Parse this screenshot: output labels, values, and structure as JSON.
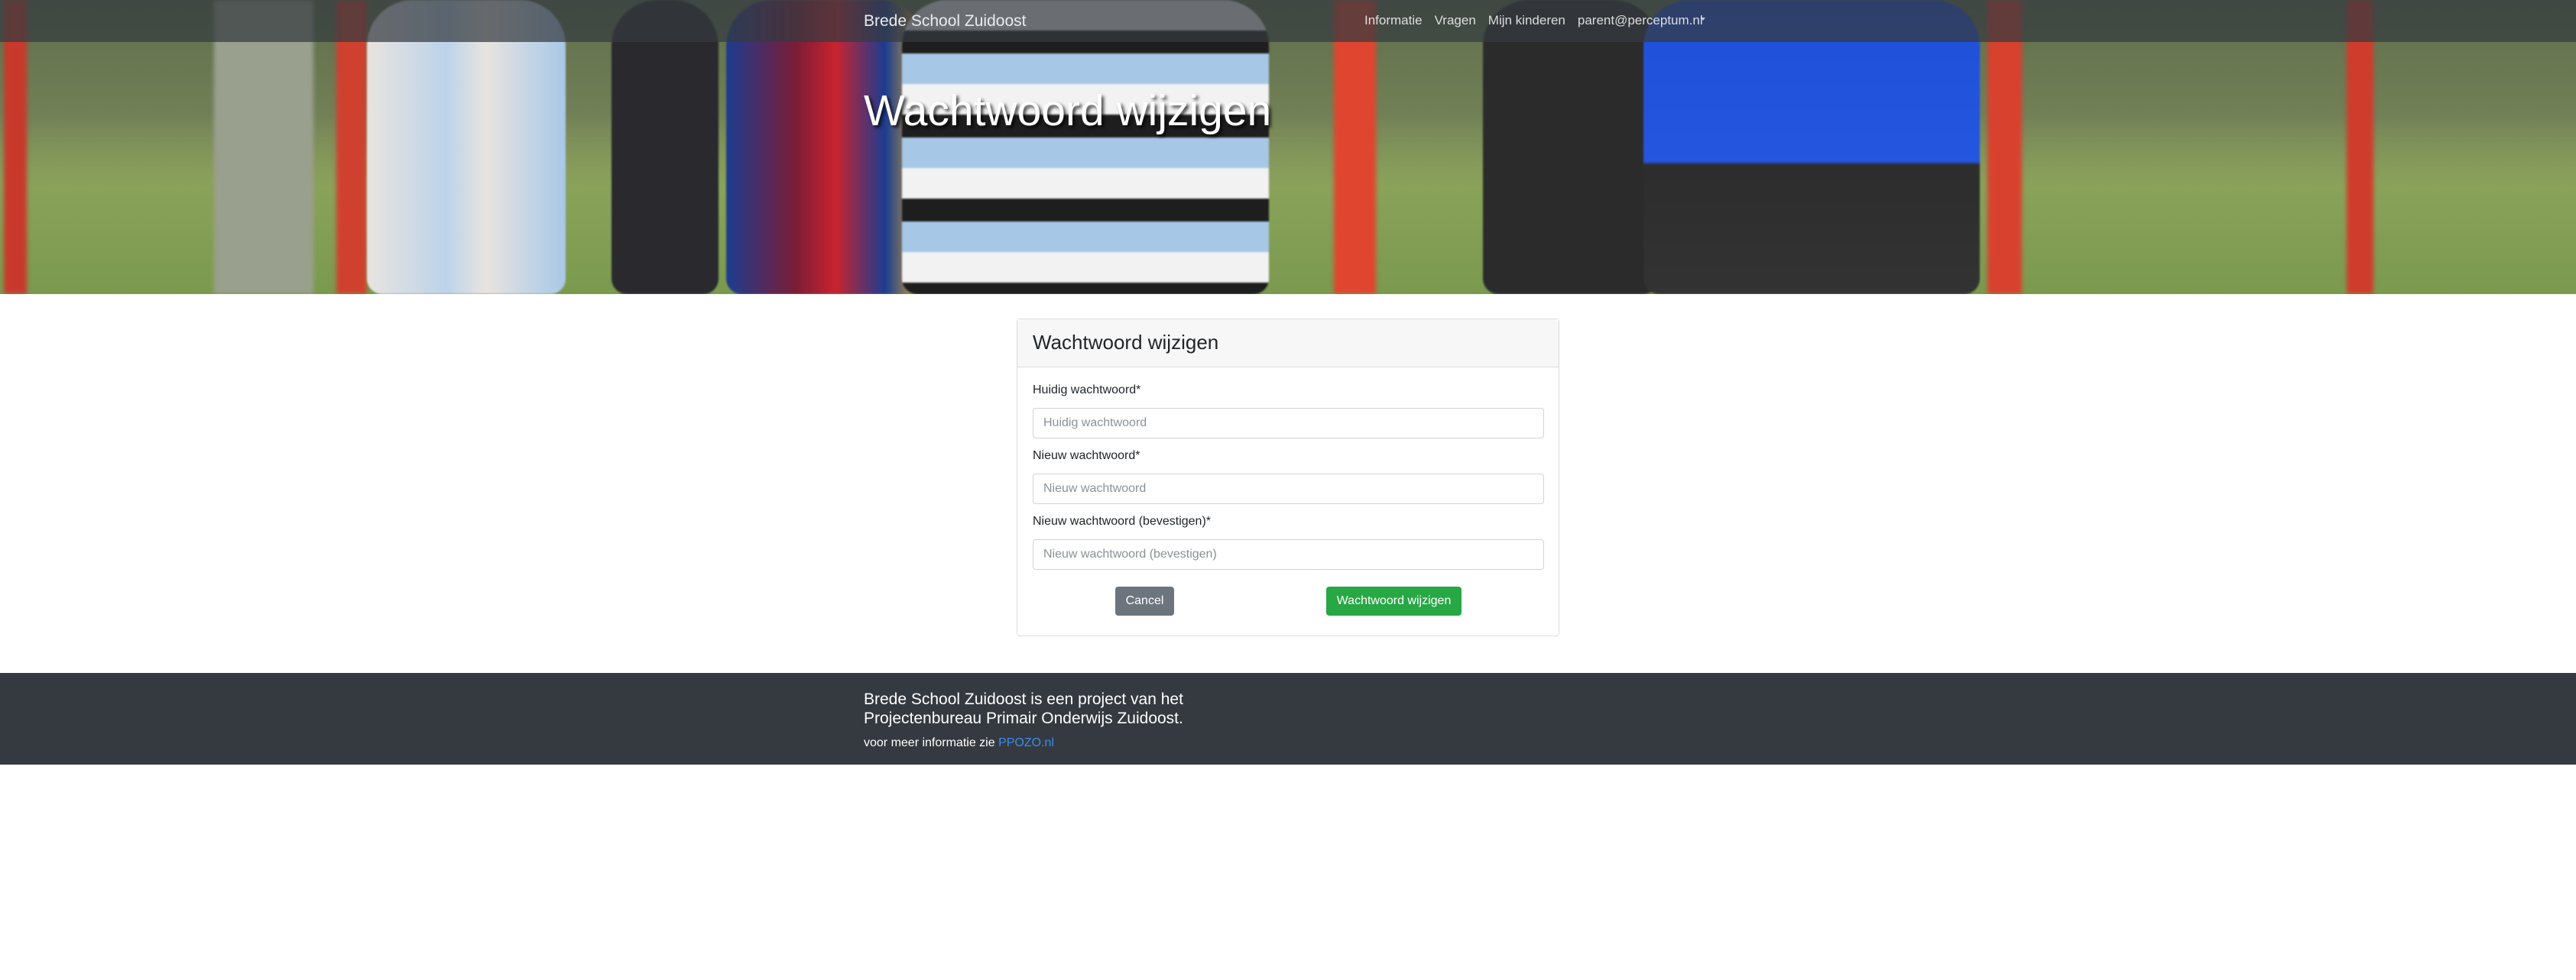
{
  "navbar": {
    "brand": "Brede School Zuidoost",
    "links": [
      "Informatie",
      "Vragen",
      "Mijn kinderen",
      "parent@perceptum.nl"
    ],
    "dropdown_icon": "caret-down-icon"
  },
  "hero": {
    "title": "Wachtwoord wijzigen"
  },
  "form": {
    "title": "Wachtwoord wijzigen",
    "fields": [
      {
        "label": "Huidig wachtwoord*",
        "placeholder": "Huidig wachtwoord",
        "value": ""
      },
      {
        "label": "Nieuw wachtwoord*",
        "placeholder": "Nieuw wachtwoord",
        "value": ""
      },
      {
        "label": "Nieuw wachtwoord (bevestigen)*",
        "placeholder": "Nieuw wachtwoord (bevestigen)",
        "value": ""
      }
    ],
    "cancel_label": "Cancel",
    "submit_label": "Wachtwoord wijzigen"
  },
  "footer": {
    "text": "Brede School Zuidoost is een project van het Projectenbureau Primair Onderwijs Zuidoost.",
    "more_prefix": "voor meer informatie zie",
    "link_text": "PPOZO.nl"
  },
  "colors": {
    "navbar": "#343a40",
    "footer": "#343a40",
    "cancel_button": "#6c757d",
    "submit_button": "#28a745",
    "link": "#3b8cf0"
  }
}
